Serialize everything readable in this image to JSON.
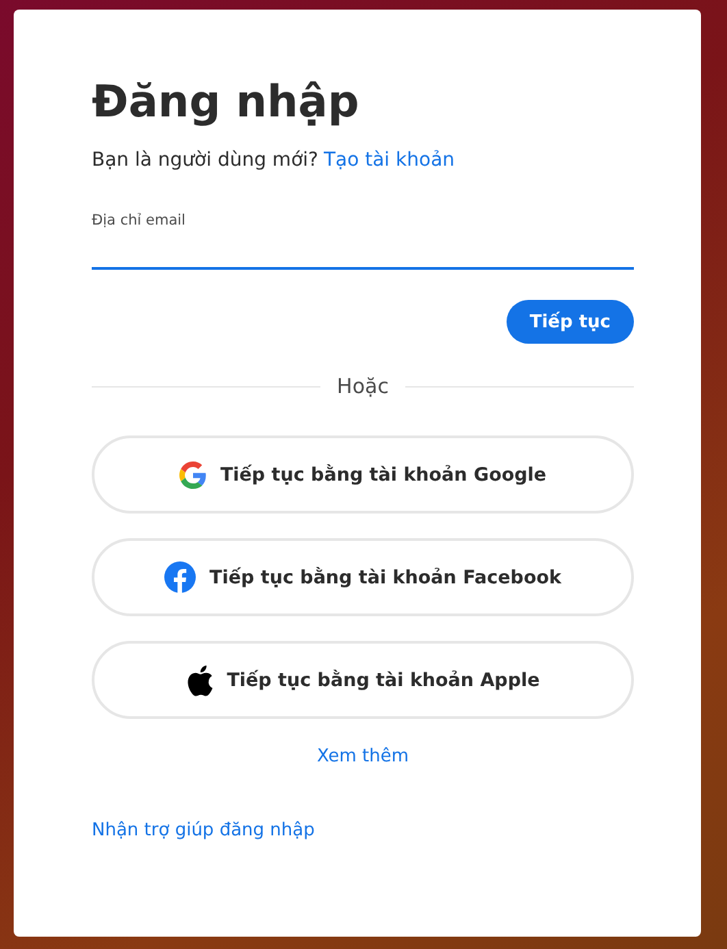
{
  "title": "Đăng nhập",
  "signup_prompt": {
    "text": "Bạn là người dùng mới?",
    "link": "Tạo tài khoản"
  },
  "email_field": {
    "label": "Địa chỉ email",
    "focused": true
  },
  "continue_button": "Tiếp tục",
  "divider_text": "Hoặc",
  "providers": [
    {
      "kind": "google",
      "label": "Tiếp tục bằng tài khoản Google"
    },
    {
      "kind": "facebook",
      "label": "Tiếp tục bằng tài khoản Facebook"
    },
    {
      "kind": "apple",
      "label": "Tiếp tục bằng tài khoản Apple"
    }
  ],
  "more_link": "Xem thêm",
  "help_link": "Nhận trợ giúp đăng nhập"
}
